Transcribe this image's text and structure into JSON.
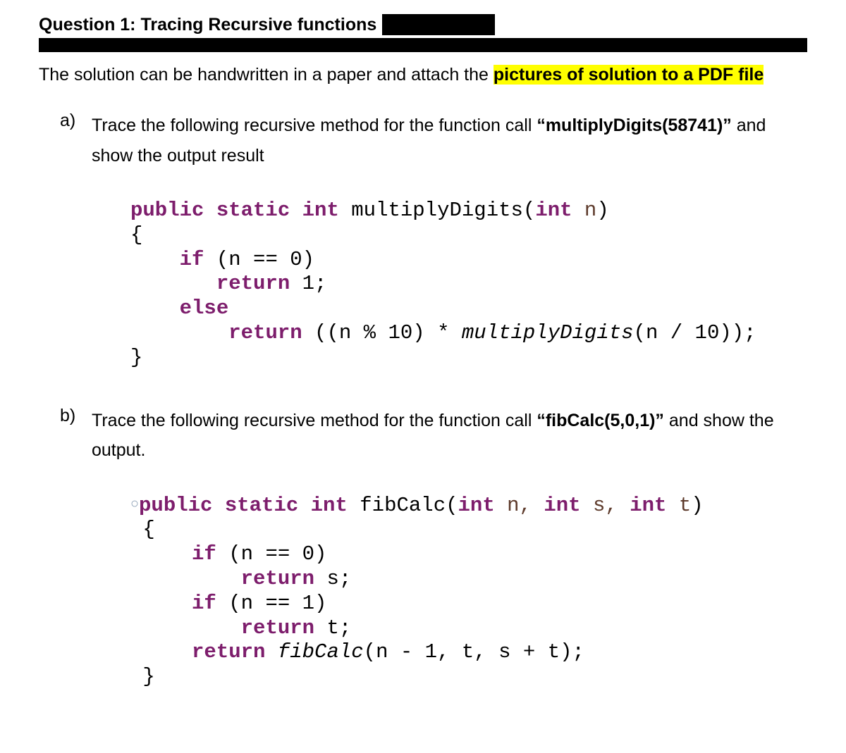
{
  "title": "Question 1: Tracing Recursive functions",
  "intro_pre": "The solution can be handwritten in a paper and attach the ",
  "intro_highlight": "pictures of solution to a PDF file",
  "part_a": {
    "label": "a)",
    "text_pre": "Trace the following recursive method for the function call ",
    "call": "“multiplyDigits(58741)”",
    "text_post": " and show the output result"
  },
  "code_a": {
    "sig_kw1": "public static int",
    "sig_fn": " multiplyDigits(",
    "sig_kw2": "int",
    "sig_var": " n",
    "sig_close": ")",
    "open": "{",
    "if_kw": "if",
    "if_expr": " (n == 0)",
    "ret1_kw": "return",
    "ret1_val": " 1;",
    "else_kw": "else",
    "ret2_kw": "return",
    "ret2_expr_a": " ((n % 10) * ",
    "ret2_call": "multiplyDigits",
    "ret2_expr_b": "(n / 10));",
    "close": "}"
  },
  "part_b": {
    "label": "b)",
    "text_pre": "Trace the following recursive method for the function call ",
    "call": "“fibCalc(5,0,1)”",
    "text_post": "  and show the output."
  },
  "code_b": {
    "dot": "○",
    "sig_kw1": "public static int",
    "sig_fn": " fibCalc(",
    "sig_kw2": "int",
    "sig_v1": " n, ",
    "sig_kw3": "int",
    "sig_v2": " s, ",
    "sig_kw4": "int",
    "sig_v3": " t",
    "sig_close": ")",
    "open": "{",
    "if1_kw": "if",
    "if1_expr": " (n == 0)",
    "ret1_kw": "return",
    "ret1_val": " s;",
    "if2_kw": "if",
    "if2_expr": " (n == 1)",
    "ret2_kw": "return",
    "ret2_val": " t;",
    "ret3_kw": "return",
    "ret3_call": " fibCalc",
    "ret3_args": "(n - 1, t, s + t);",
    "close": "}"
  }
}
